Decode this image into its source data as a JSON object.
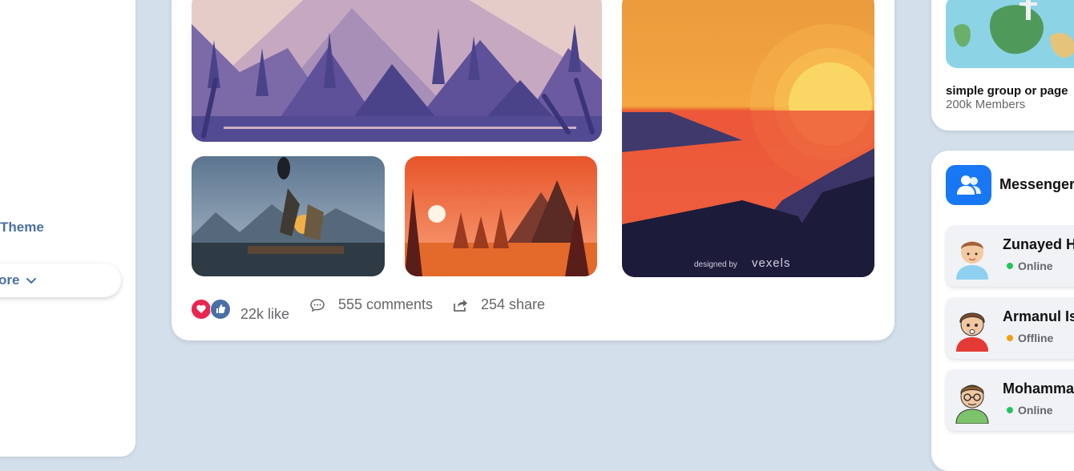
{
  "left_sidebar": {
    "theme_label": "Theme",
    "more_label": "ore"
  },
  "post": {
    "likes": "22k like",
    "comments": "555 comments",
    "shares": "254 share",
    "watermark_prefix": "designed by",
    "watermark_brand": "vexels"
  },
  "group": {
    "name": "simple group or page",
    "members": "200k Members"
  },
  "messenger": {
    "title": "Messenger",
    "contacts": [
      {
        "name": "Zunayed H",
        "status": "Online",
        "status_color": "#22c55e"
      },
      {
        "name": "Armanul Is",
        "status": "Offline",
        "status_color": "#f59e0b"
      },
      {
        "name": "Mohamma",
        "status": "Online",
        "status_color": "#22c55e"
      }
    ]
  },
  "colors": {
    "background": "#d3dfeb",
    "accent_blue": "#4a6fa5",
    "messenger_blue": "#1877f2",
    "love_red": "#e8264f"
  }
}
